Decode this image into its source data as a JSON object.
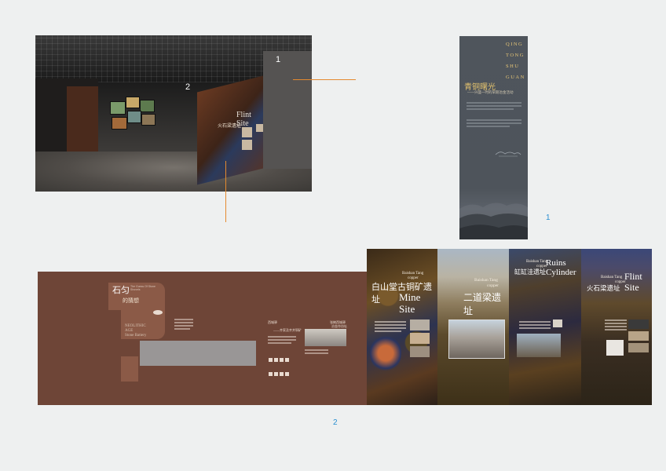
{
  "render": {
    "marker_1": "1",
    "marker_2": "2",
    "sign_flint": "Flint",
    "sign_site": "Site",
    "sign_cn": "火石梁遗址"
  },
  "banner": {
    "vertical_letters": [
      "QING",
      "TONG",
      "SHU",
      "GUAN"
    ],
    "title": "青铜曙光",
    "subtitle": "——兴盛一时的早期冶金活动"
  },
  "labels": {
    "one": "1",
    "two": "2"
  },
  "strip": {
    "title": "石匀",
    "title_sub": "的猜想",
    "title_en": "The Guess Of Stone Shovels",
    "age_lines": [
      "NEOLITHIC",
      "AGE",
      "Stone Battery"
    ],
    "text_a_title": "西城驿",
    "text_a_sub": "——齐家及齐并铜矿",
    "text_b_title": "张掖西城驿",
    "text_b_sub": "冶金作坊址"
  },
  "panels": [
    {
      "en_top": "Baishan Tang",
      "en_small": "copper",
      "cn": "白山堂古铜矿遗址",
      "en_big_1": "Mine",
      "en_big_2": "Site"
    },
    {
      "en_top": "Baishan Tang",
      "en_small": "copper",
      "cn": "二道梁遗址"
    },
    {
      "en_top": "Baishan Tang",
      "en_small": "copper",
      "cn": "缸缸洼遗址",
      "en_big_1": "Ruins",
      "en_big_2": "Cylinder"
    },
    {
      "en_top": "Baishan Tang",
      "en_small": "copper",
      "cn": "火石梁遗址",
      "en_big_1": "Flint",
      "en_big_2": "Site"
    }
  ],
  "colors": {
    "accent_line": "#e48a2f",
    "label_blue": "#2a8fd0",
    "strip_brown": "#6e4537"
  }
}
